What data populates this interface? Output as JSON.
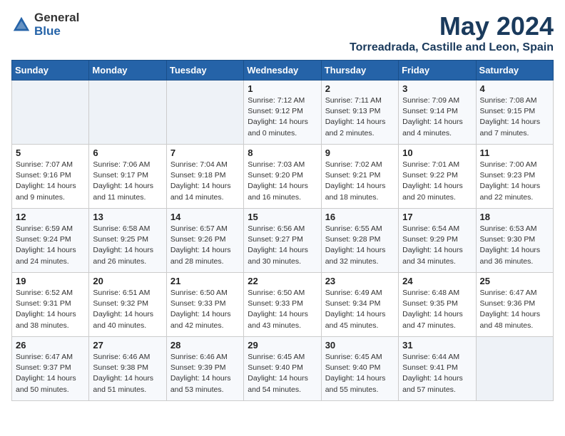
{
  "header": {
    "logo_general": "General",
    "logo_blue": "Blue",
    "month_year": "May 2024",
    "location": "Torreadrada, Castille and Leon, Spain"
  },
  "days_of_week": [
    "Sunday",
    "Monday",
    "Tuesday",
    "Wednesday",
    "Thursday",
    "Friday",
    "Saturday"
  ],
  "weeks": [
    [
      {
        "day": "",
        "info": ""
      },
      {
        "day": "",
        "info": ""
      },
      {
        "day": "",
        "info": ""
      },
      {
        "day": "1",
        "sunrise": "Sunrise: 7:12 AM",
        "sunset": "Sunset: 9:12 PM",
        "daylight": "Daylight: 14 hours and 0 minutes."
      },
      {
        "day": "2",
        "sunrise": "Sunrise: 7:11 AM",
        "sunset": "Sunset: 9:13 PM",
        "daylight": "Daylight: 14 hours and 2 minutes."
      },
      {
        "day": "3",
        "sunrise": "Sunrise: 7:09 AM",
        "sunset": "Sunset: 9:14 PM",
        "daylight": "Daylight: 14 hours and 4 minutes."
      },
      {
        "day": "4",
        "sunrise": "Sunrise: 7:08 AM",
        "sunset": "Sunset: 9:15 PM",
        "daylight": "Daylight: 14 hours and 7 minutes."
      }
    ],
    [
      {
        "day": "5",
        "sunrise": "Sunrise: 7:07 AM",
        "sunset": "Sunset: 9:16 PM",
        "daylight": "Daylight: 14 hours and 9 minutes."
      },
      {
        "day": "6",
        "sunrise": "Sunrise: 7:06 AM",
        "sunset": "Sunset: 9:17 PM",
        "daylight": "Daylight: 14 hours and 11 minutes."
      },
      {
        "day": "7",
        "sunrise": "Sunrise: 7:04 AM",
        "sunset": "Sunset: 9:18 PM",
        "daylight": "Daylight: 14 hours and 14 minutes."
      },
      {
        "day": "8",
        "sunrise": "Sunrise: 7:03 AM",
        "sunset": "Sunset: 9:20 PM",
        "daylight": "Daylight: 14 hours and 16 minutes."
      },
      {
        "day": "9",
        "sunrise": "Sunrise: 7:02 AM",
        "sunset": "Sunset: 9:21 PM",
        "daylight": "Daylight: 14 hours and 18 minutes."
      },
      {
        "day": "10",
        "sunrise": "Sunrise: 7:01 AM",
        "sunset": "Sunset: 9:22 PM",
        "daylight": "Daylight: 14 hours and 20 minutes."
      },
      {
        "day": "11",
        "sunrise": "Sunrise: 7:00 AM",
        "sunset": "Sunset: 9:23 PM",
        "daylight": "Daylight: 14 hours and 22 minutes."
      }
    ],
    [
      {
        "day": "12",
        "sunrise": "Sunrise: 6:59 AM",
        "sunset": "Sunset: 9:24 PM",
        "daylight": "Daylight: 14 hours and 24 minutes."
      },
      {
        "day": "13",
        "sunrise": "Sunrise: 6:58 AM",
        "sunset": "Sunset: 9:25 PM",
        "daylight": "Daylight: 14 hours and 26 minutes."
      },
      {
        "day": "14",
        "sunrise": "Sunrise: 6:57 AM",
        "sunset": "Sunset: 9:26 PM",
        "daylight": "Daylight: 14 hours and 28 minutes."
      },
      {
        "day": "15",
        "sunrise": "Sunrise: 6:56 AM",
        "sunset": "Sunset: 9:27 PM",
        "daylight": "Daylight: 14 hours and 30 minutes."
      },
      {
        "day": "16",
        "sunrise": "Sunrise: 6:55 AM",
        "sunset": "Sunset: 9:28 PM",
        "daylight": "Daylight: 14 hours and 32 minutes."
      },
      {
        "day": "17",
        "sunrise": "Sunrise: 6:54 AM",
        "sunset": "Sunset: 9:29 PM",
        "daylight": "Daylight: 14 hours and 34 minutes."
      },
      {
        "day": "18",
        "sunrise": "Sunrise: 6:53 AM",
        "sunset": "Sunset: 9:30 PM",
        "daylight": "Daylight: 14 hours and 36 minutes."
      }
    ],
    [
      {
        "day": "19",
        "sunrise": "Sunrise: 6:52 AM",
        "sunset": "Sunset: 9:31 PM",
        "daylight": "Daylight: 14 hours and 38 minutes."
      },
      {
        "day": "20",
        "sunrise": "Sunrise: 6:51 AM",
        "sunset": "Sunset: 9:32 PM",
        "daylight": "Daylight: 14 hours and 40 minutes."
      },
      {
        "day": "21",
        "sunrise": "Sunrise: 6:50 AM",
        "sunset": "Sunset: 9:33 PM",
        "daylight": "Daylight: 14 hours and 42 minutes."
      },
      {
        "day": "22",
        "sunrise": "Sunrise: 6:50 AM",
        "sunset": "Sunset: 9:33 PM",
        "daylight": "Daylight: 14 hours and 43 minutes."
      },
      {
        "day": "23",
        "sunrise": "Sunrise: 6:49 AM",
        "sunset": "Sunset: 9:34 PM",
        "daylight": "Daylight: 14 hours and 45 minutes."
      },
      {
        "day": "24",
        "sunrise": "Sunrise: 6:48 AM",
        "sunset": "Sunset: 9:35 PM",
        "daylight": "Daylight: 14 hours and 47 minutes."
      },
      {
        "day": "25",
        "sunrise": "Sunrise: 6:47 AM",
        "sunset": "Sunset: 9:36 PM",
        "daylight": "Daylight: 14 hours and 48 minutes."
      }
    ],
    [
      {
        "day": "26",
        "sunrise": "Sunrise: 6:47 AM",
        "sunset": "Sunset: 9:37 PM",
        "daylight": "Daylight: 14 hours and 50 minutes."
      },
      {
        "day": "27",
        "sunrise": "Sunrise: 6:46 AM",
        "sunset": "Sunset: 9:38 PM",
        "daylight": "Daylight: 14 hours and 51 minutes."
      },
      {
        "day": "28",
        "sunrise": "Sunrise: 6:46 AM",
        "sunset": "Sunset: 9:39 PM",
        "daylight": "Daylight: 14 hours and 53 minutes."
      },
      {
        "day": "29",
        "sunrise": "Sunrise: 6:45 AM",
        "sunset": "Sunset: 9:40 PM",
        "daylight": "Daylight: 14 hours and 54 minutes."
      },
      {
        "day": "30",
        "sunrise": "Sunrise: 6:45 AM",
        "sunset": "Sunset: 9:40 PM",
        "daylight": "Daylight: 14 hours and 55 minutes."
      },
      {
        "day": "31",
        "sunrise": "Sunrise: 6:44 AM",
        "sunset": "Sunset: 9:41 PM",
        "daylight": "Daylight: 14 hours and 57 minutes."
      },
      {
        "day": "",
        "info": ""
      }
    ]
  ]
}
